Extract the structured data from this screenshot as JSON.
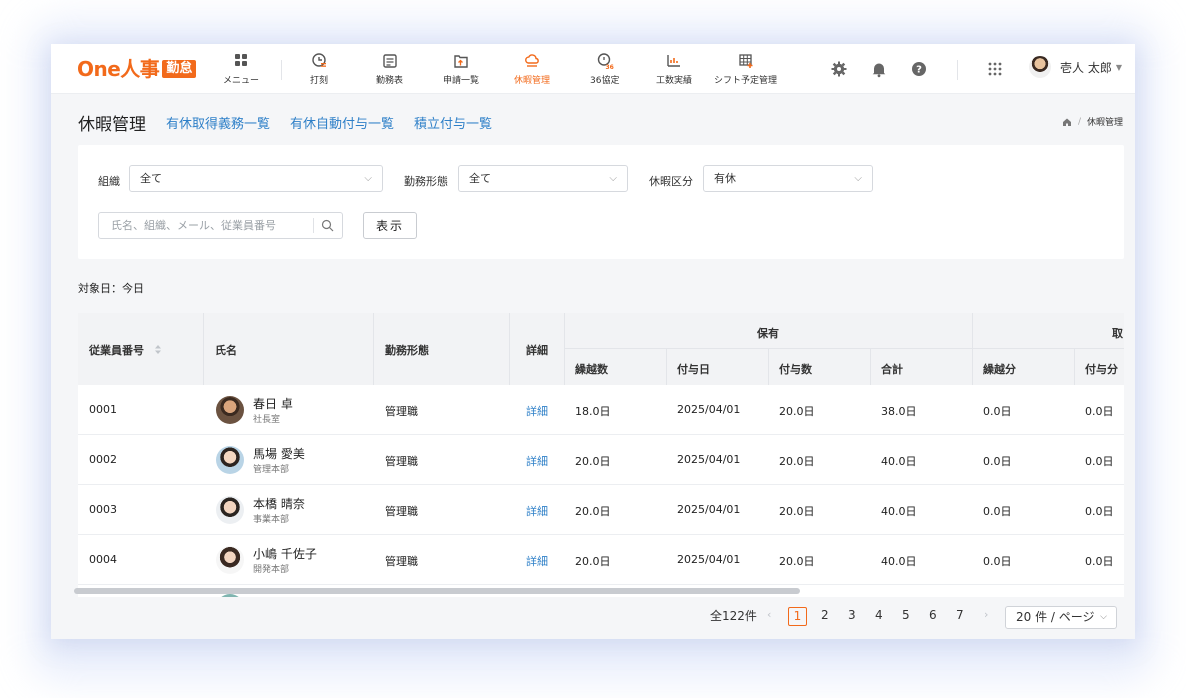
{
  "brand": {
    "logo_main": "One人事",
    "logo_badge": "勤怠",
    "accent": "#f26a1b",
    "link": "#2f80c8"
  },
  "nav": {
    "menu": "メニュー",
    "items": [
      {
        "label": "打刻",
        "icon": "clock-stamp-icon"
      },
      {
        "label": "勤務表",
        "icon": "timesheet-icon"
      },
      {
        "label": "申請一覧",
        "icon": "request-list-icon"
      },
      {
        "label": "休暇管理",
        "icon": "cloud-leave-icon",
        "active": true
      },
      {
        "label": "36協定",
        "icon": "agreement-36-icon"
      },
      {
        "label": "工数実績",
        "icon": "workload-chart-icon"
      },
      {
        "label": "シフト予定管理",
        "icon": "shift-grid-icon"
      }
    ]
  },
  "user": {
    "name": "壱人 太郎"
  },
  "page": {
    "title": "休暇管理",
    "links": [
      "有休取得義務一覧",
      "有休自動付与一覧",
      "積立付与一覧"
    ],
    "breadcrumb_current": "休暇管理"
  },
  "filters": {
    "org_label": "組織",
    "org_value": "全て",
    "work_label": "勤務形態",
    "work_value": "全て",
    "leave_label": "休暇区分",
    "leave_value": "有休",
    "search_placeholder": "氏名、組織、メール、従業員番号",
    "show_button": "表示"
  },
  "target_date": "対象日：今日",
  "table": {
    "headers": {
      "emp_no": "従業員番号",
      "name": "氏名",
      "work_type": "勤務形態",
      "detail": "詳細",
      "group_hold": "保有",
      "group_take": "取",
      "carryover": "繰越数",
      "grant_date": "付与日",
      "grant_count": "付与数",
      "total": "合計",
      "carry_part": "繰越分",
      "grant_part": "付与分"
    },
    "rows": [
      {
        "emp_no": "0001",
        "name": "春日 卓",
        "dept": "社長室",
        "work_type": "管理職",
        "detail": "詳細",
        "carryover": "18.0日",
        "grant_date": "2025/04/01",
        "grant_count": "20.0日",
        "total": "38.0日",
        "carry_part": "0.0日",
        "grant_part": "0.0日"
      },
      {
        "emp_no": "0002",
        "name": "馬場 愛美",
        "dept": "管理本部",
        "work_type": "管理職",
        "detail": "詳細",
        "carryover": "20.0日",
        "grant_date": "2025/04/01",
        "grant_count": "20.0日",
        "total": "40.0日",
        "carry_part": "0.0日",
        "grant_part": "0.0日"
      },
      {
        "emp_no": "0003",
        "name": "本橋 晴奈",
        "dept": "事業本部",
        "work_type": "管理職",
        "detail": "詳細",
        "carryover": "20.0日",
        "grant_date": "2025/04/01",
        "grant_count": "20.0日",
        "total": "40.0日",
        "carry_part": "0.0日",
        "grant_part": "0.0日"
      },
      {
        "emp_no": "0004",
        "name": "小嶋 千佐子",
        "dept": "開発本部",
        "work_type": "管理職",
        "detail": "詳細",
        "carryover": "20.0日",
        "grant_date": "2025/04/01",
        "grant_count": "20.0日",
        "total": "40.0日",
        "carry_part": "0.0日",
        "grant_part": "0.0日"
      }
    ]
  },
  "pagination": {
    "total": "全122件",
    "pages": [
      "1",
      "2",
      "3",
      "4",
      "5",
      "6",
      "7"
    ],
    "current": "1",
    "page_size": "20 件 / ページ"
  }
}
